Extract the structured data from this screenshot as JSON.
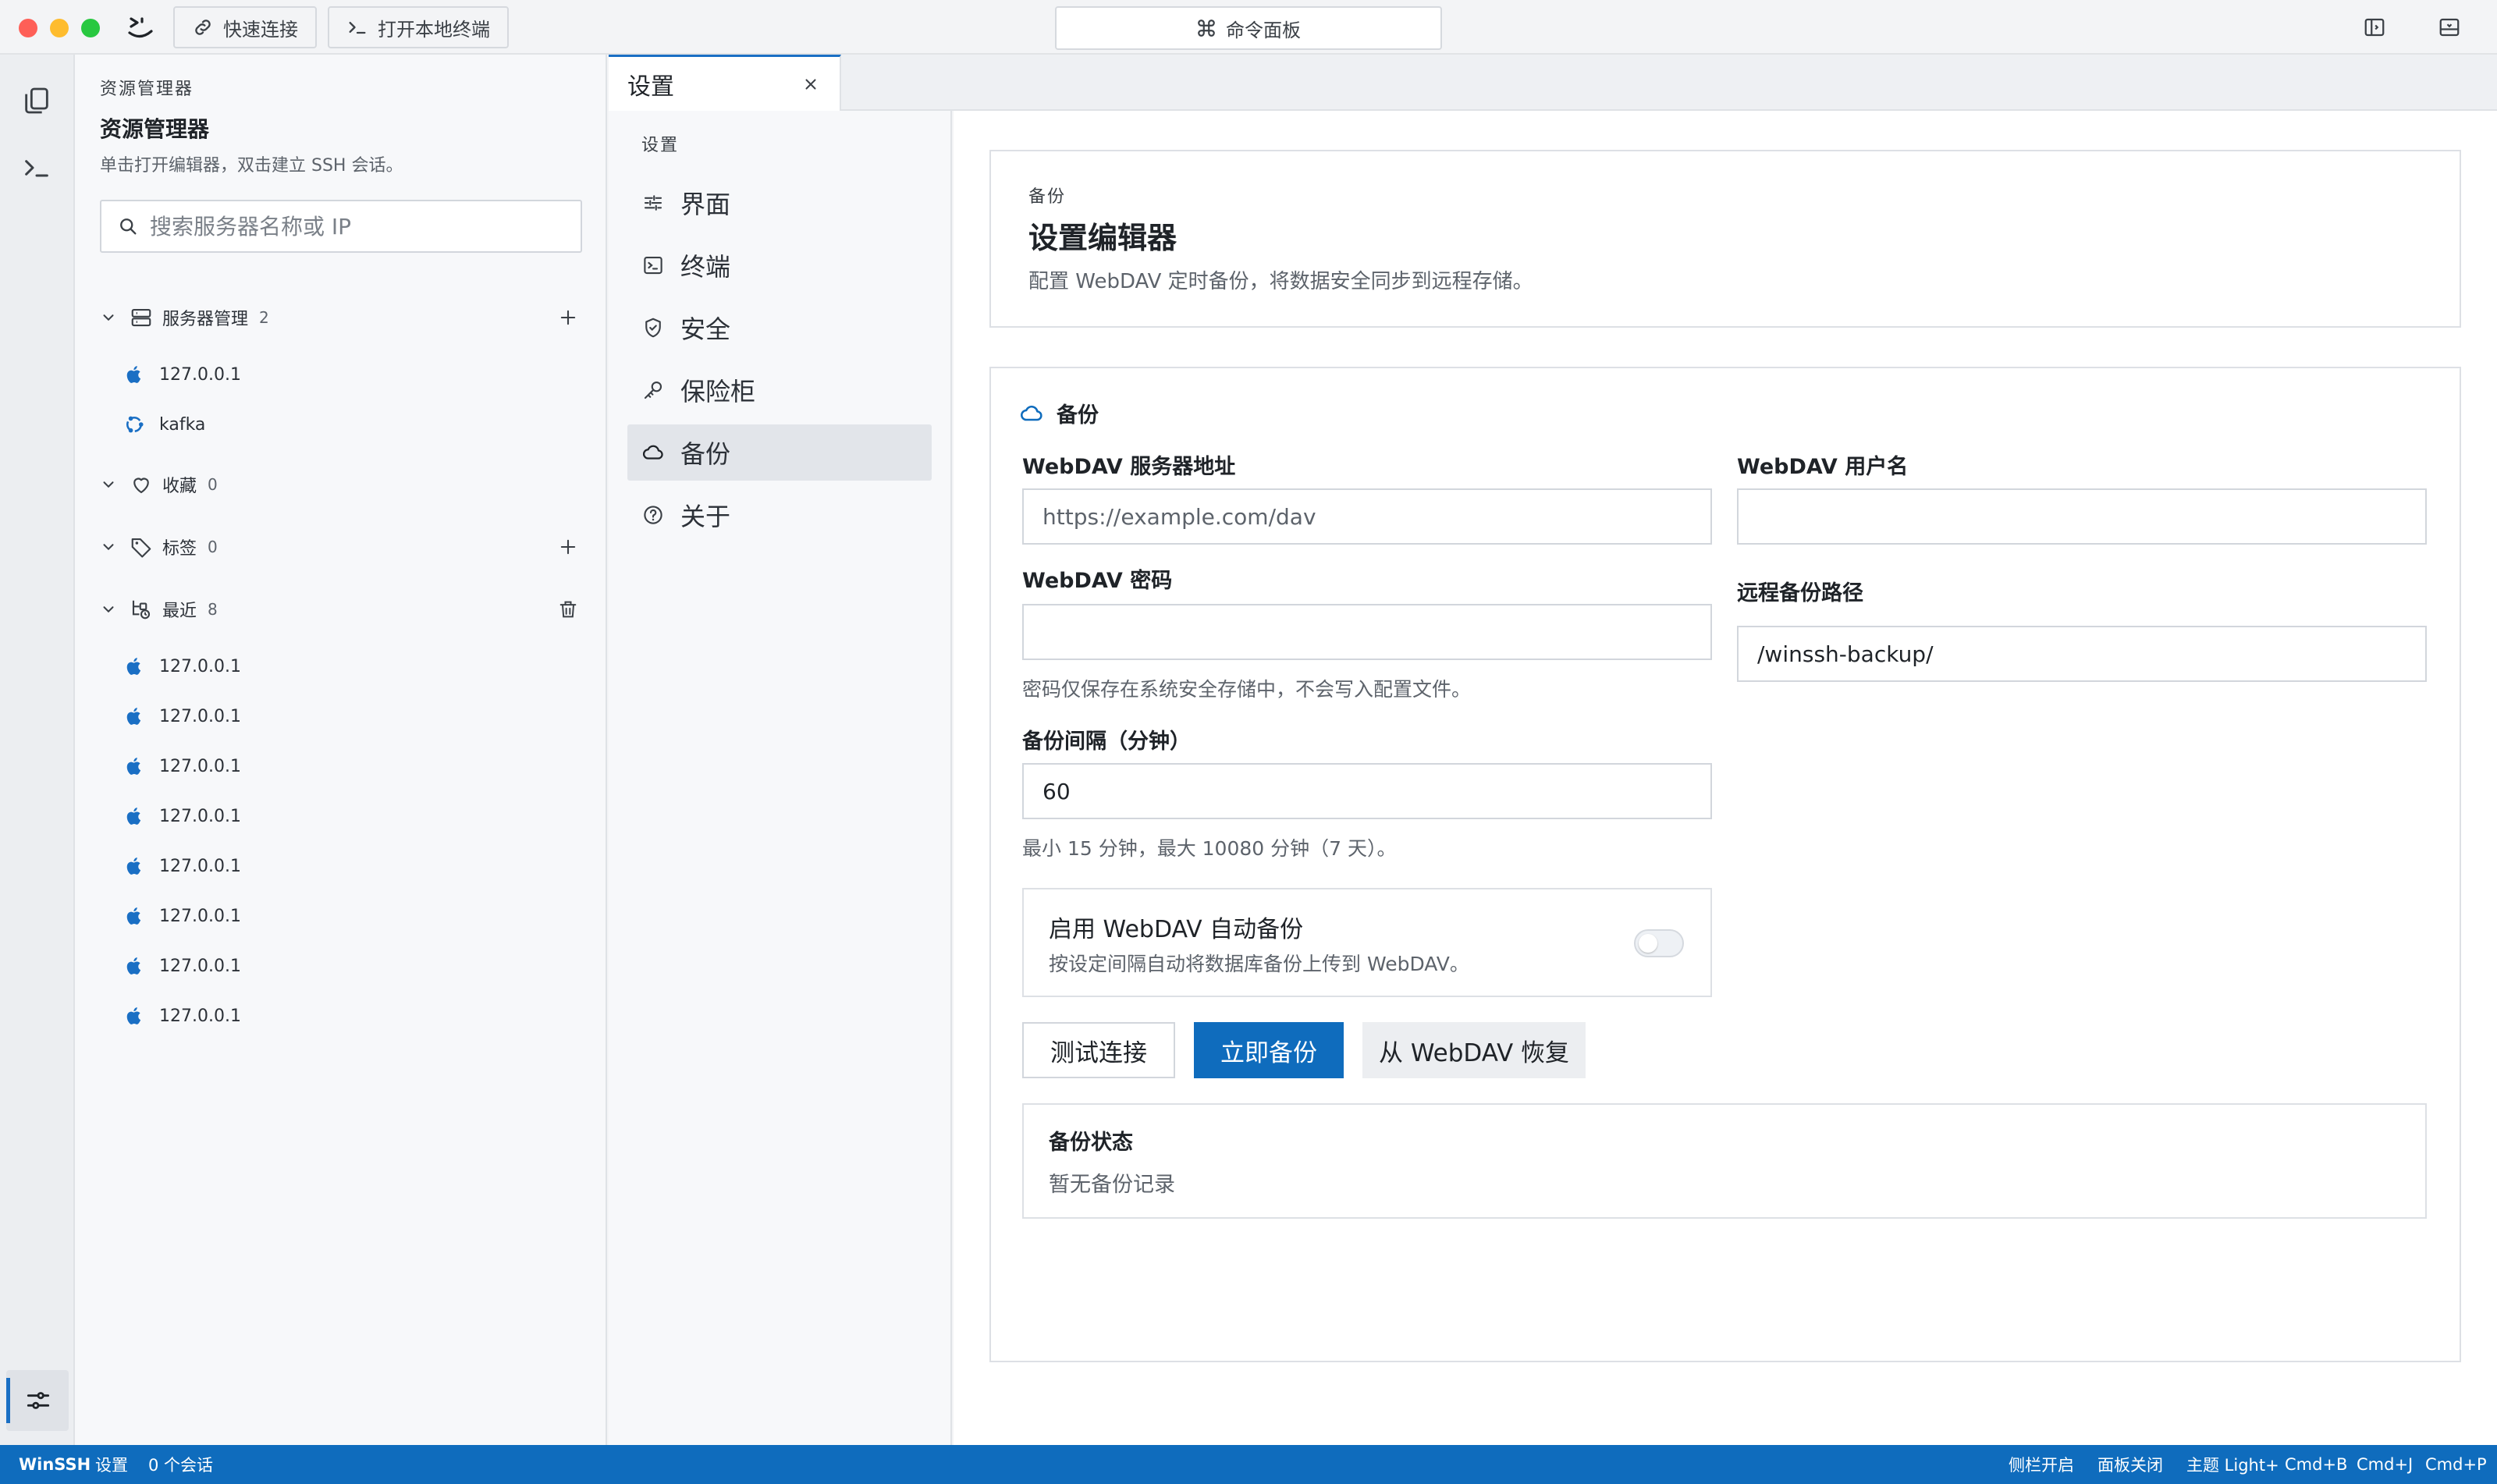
{
  "titlebar": {
    "quick_connect": "快速连接",
    "open_local_terminal": "打开本地终端",
    "command_palette": "命令面板"
  },
  "explorer": {
    "caption": "资源管理器",
    "title": "资源管理器",
    "subtitle": "单击打开编辑器，双击建立 SSH 会话。",
    "search_placeholder": "搜索服务器名称或 IP",
    "server_group": {
      "label": "服务器管理",
      "count": "2"
    },
    "servers": [
      {
        "name": "127.0.0.1",
        "icon": "apple-icon"
      },
      {
        "name": "kafka",
        "icon": "ubuntu-icon"
      }
    ],
    "favorites": {
      "label": "收藏",
      "count": "0"
    },
    "tags": {
      "label": "标签",
      "count": "0"
    },
    "recent": {
      "label": "最近",
      "count": "8"
    },
    "recent_items": [
      "127.0.0.1",
      "127.0.0.1",
      "127.0.0.1",
      "127.0.0.1",
      "127.0.0.1",
      "127.0.0.1",
      "127.0.0.1",
      "127.0.0.1"
    ]
  },
  "tab": {
    "label": "设置"
  },
  "settings_nav": {
    "caption": "设置",
    "items": [
      {
        "label": "界面",
        "icon": "sliders-icon"
      },
      {
        "label": "终端",
        "icon": "terminal-icon"
      },
      {
        "label": "安全",
        "icon": "shield-icon"
      },
      {
        "label": "保险柜",
        "icon": "key-icon"
      },
      {
        "label": "备份",
        "icon": "cloud-icon",
        "active": true
      },
      {
        "label": "关于",
        "icon": "help-icon"
      }
    ]
  },
  "header_card": {
    "caption": "备份",
    "title": "设置编辑器",
    "description": "配置 WebDAV 定时备份，将数据安全同步到远程存储。"
  },
  "backup": {
    "section_title": "备份",
    "server_label": "WebDAV 服务器地址",
    "server_placeholder": "https://example.com/dav",
    "username_label": "WebDAV 用户名",
    "password_label": "WebDAV 密码",
    "password_hint": "密码仅保存在系统安全存储中，不会写入配置文件。",
    "remote_path_label": "远程备份路径",
    "remote_path_value": "/winssh-backup/",
    "interval_label": "备份间隔（分钟）",
    "interval_value": "60",
    "interval_hint": "最小 15 分钟，最大 10080 分钟（7 天）。",
    "auto_title": "启用 WebDAV 自动备份",
    "auto_desc": "按设定间隔自动将数据库备份上传到 WebDAV。",
    "auto_enabled": false,
    "btn_test": "测试连接",
    "btn_backup_now": "立即备份",
    "btn_restore": "从 WebDAV 恢复",
    "status_title": "备份状态",
    "status_text": "暂无备份记录"
  },
  "statusbar": {
    "app": "WinSSH",
    "page": "设置",
    "sessions": "0 个会话",
    "sidebar": "侧栏开启",
    "panel": "面板关闭",
    "theme": "主题 Light+",
    "shortcut_b": "Cmd+B",
    "shortcut_j": "Cmd+J",
    "shortcut_p": "Cmd+P"
  },
  "colors": {
    "accent": "#0f6cbd",
    "close_light": "#fe5f57",
    "minimize_light": "#febc2e",
    "zoom_light": "#28c840"
  }
}
